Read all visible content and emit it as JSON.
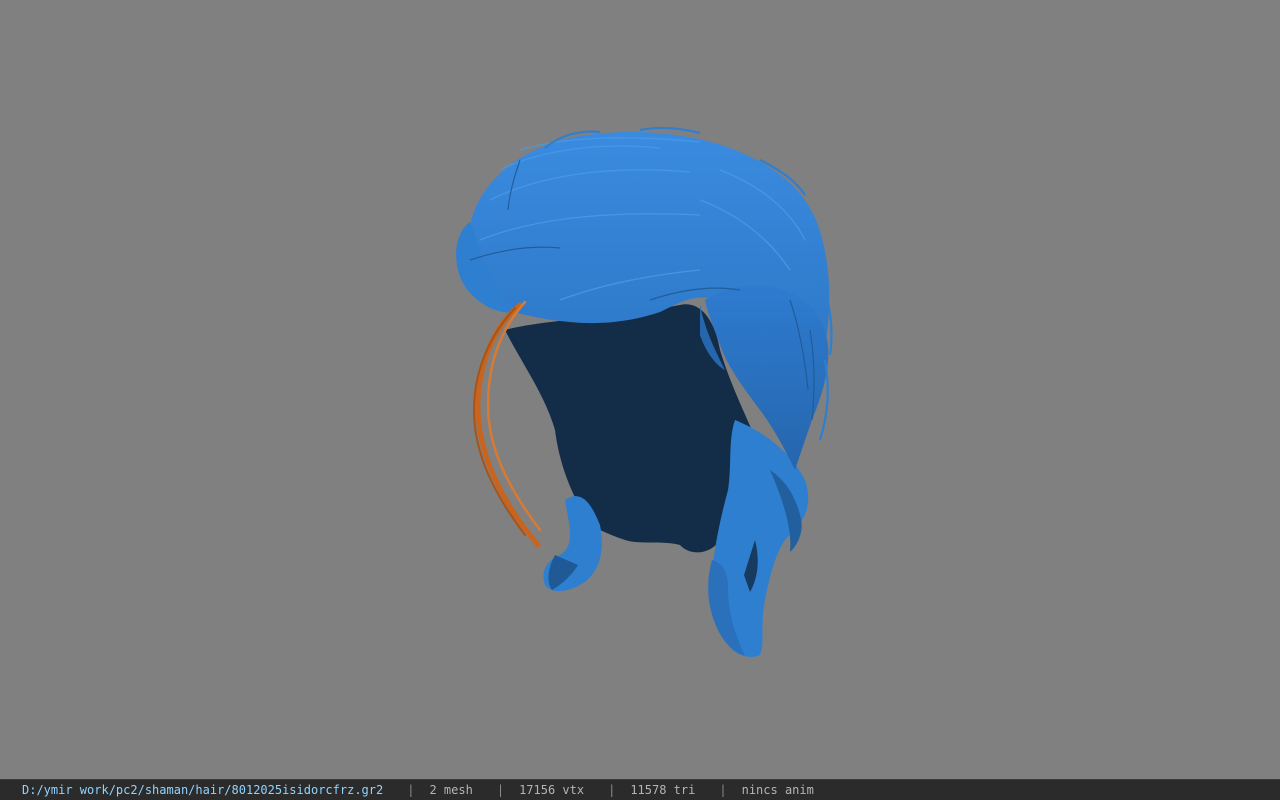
{
  "viewer": {
    "background_color": "#808080",
    "model_colors": {
      "hair_light": "#2f7fd0",
      "hair_mid": "#2a6fb8",
      "hair_shadow": "#132d48",
      "accent_strand": "#c8641e"
    }
  },
  "status_bar": {
    "file_path": "D:/ymir work/pc2/shaman/hair/8012025isidorcfrz.gr2",
    "separator": "|",
    "mesh_count": "2 mesh",
    "vertex_count": "17156 vtx",
    "triangle_count": "11578 tri",
    "anim_status": "nincs anim"
  }
}
